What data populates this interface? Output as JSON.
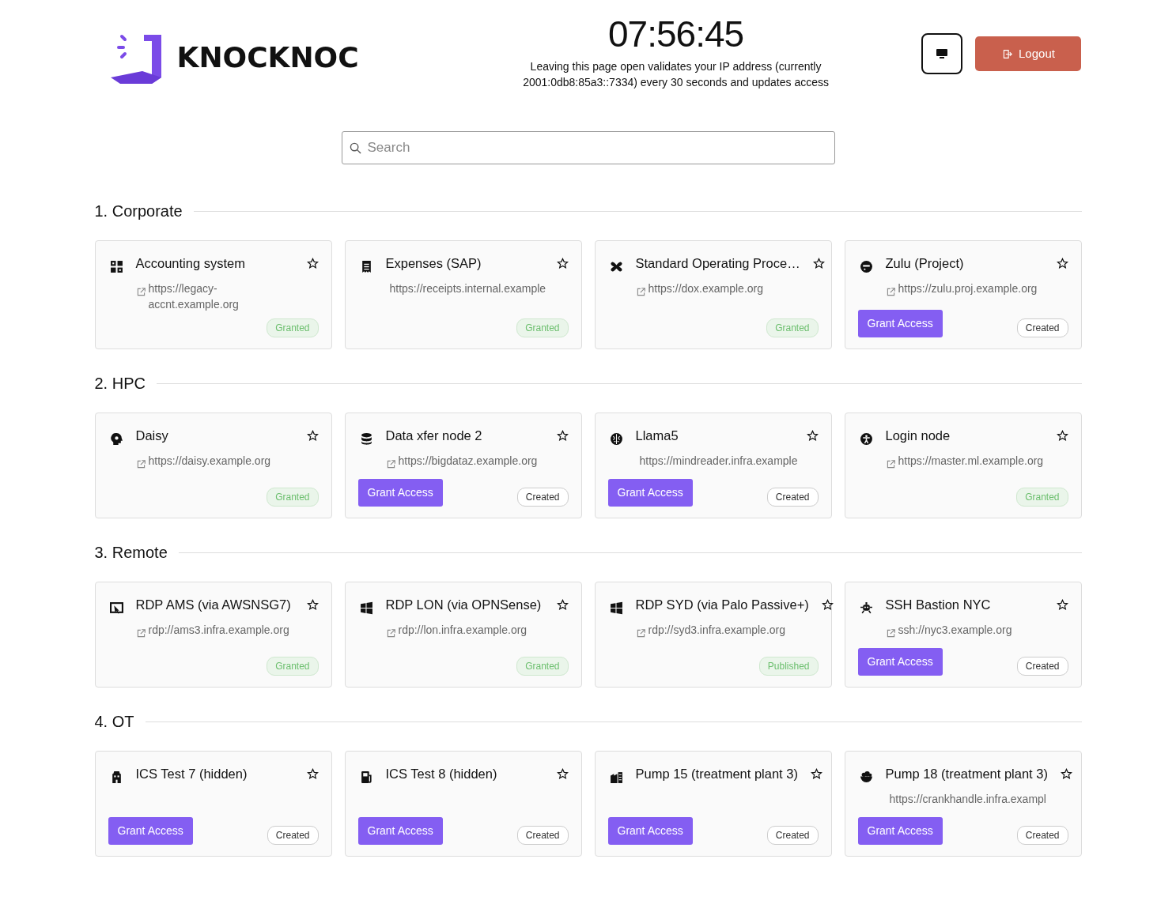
{
  "brand": {
    "name": "KNOCKNOC"
  },
  "clock": {
    "time": "07:56:45",
    "note": "Leaving this page open validates your IP address (currently 2001:0db8:85a3::7334) every 30 seconds and updates access"
  },
  "header_buttons": {
    "logout": "Logout"
  },
  "search": {
    "placeholder": "Search"
  },
  "sections": [
    {
      "title": "1. Corporate",
      "apps": [
        {
          "name": "Accounting system",
          "url": "https://legacy-accnt.example.org",
          "external": true,
          "favorite": false,
          "status": {
            "label": "Granted",
            "kind": "granted"
          }
        },
        {
          "name": "Expenses (SAP)",
          "url": "https://receipts.internal.example",
          "external": false,
          "favorite": false,
          "status": {
            "label": "Granted",
            "kind": "granted"
          }
        },
        {
          "name": "Standard Operating Proce…",
          "url": "https://dox.example.org",
          "external": true,
          "favorite": false,
          "status": {
            "label": "Granted",
            "kind": "granted"
          }
        },
        {
          "name": "Zulu (Project)",
          "url": "https://zulu.proj.example.org",
          "external": true,
          "favorite": false,
          "action": "Grant Access",
          "status": {
            "label": "Created",
            "kind": "created"
          }
        }
      ]
    },
    {
      "title": "2. HPC",
      "apps": [
        {
          "name": "Daisy",
          "url": "https://daisy.example.org",
          "external": true,
          "favorite": false,
          "status": {
            "label": "Granted",
            "kind": "granted"
          }
        },
        {
          "name": "Data xfer node 2",
          "url": "https://bigdataz.example.org",
          "external": true,
          "favorite": false,
          "action": "Grant Access",
          "status": {
            "label": "Created",
            "kind": "created"
          }
        },
        {
          "name": "Llama5",
          "url": "https://mindreader.infra.example",
          "external": false,
          "favorite": false,
          "action": "Grant Access",
          "status": {
            "label": "Created",
            "kind": "created"
          }
        },
        {
          "name": "Login node",
          "url": "https://master.ml.example.org",
          "external": true,
          "favorite": false,
          "status": {
            "label": "Granted",
            "kind": "granted"
          }
        }
      ]
    },
    {
      "title": "3. Remote",
      "apps": [
        {
          "name": "RDP AMS (via AWSNSG7)",
          "url": "rdp://ams3.infra.example.org",
          "external": true,
          "favorite": false,
          "status": {
            "label": "Granted",
            "kind": "granted"
          }
        },
        {
          "name": "RDP LON (via OPNSense)",
          "url": "rdp://lon.infra.example.org",
          "external": true,
          "favorite": false,
          "status": {
            "label": "Granted",
            "kind": "granted"
          }
        },
        {
          "name": "RDP SYD (via Palo Passive+)",
          "url": "rdp://syd3.infra.example.org",
          "external": true,
          "favorite": false,
          "status": {
            "label": "Published",
            "kind": "published"
          }
        },
        {
          "name": "SSH Bastion NYC",
          "url": "ssh://nyc3.example.org",
          "external": true,
          "favorite": false,
          "action": "Grant Access",
          "status": {
            "label": "Created",
            "kind": "created"
          }
        }
      ]
    },
    {
      "title": "4. OT",
      "apps": [
        {
          "name": "ICS Test 7 (hidden)",
          "favorite": false,
          "action": "Grant Access",
          "status": {
            "label": "Created",
            "kind": "created"
          }
        },
        {
          "name": "ICS Test 8 (hidden)",
          "favorite": false,
          "action": "Grant Access",
          "status": {
            "label": "Created",
            "kind": "created"
          }
        },
        {
          "name": "Pump 15 (treatment plant 3)",
          "favorite": false,
          "action": "Grant Access",
          "status": {
            "label": "Created",
            "kind": "created"
          }
        },
        {
          "name": "Pump 18 (treatment plant 3)",
          "url": "https://crankhandle.infra.exampl",
          "external": false,
          "favorite": false,
          "action": "Grant Access",
          "status": {
            "label": "Created",
            "kind": "created"
          }
        }
      ]
    }
  ]
}
